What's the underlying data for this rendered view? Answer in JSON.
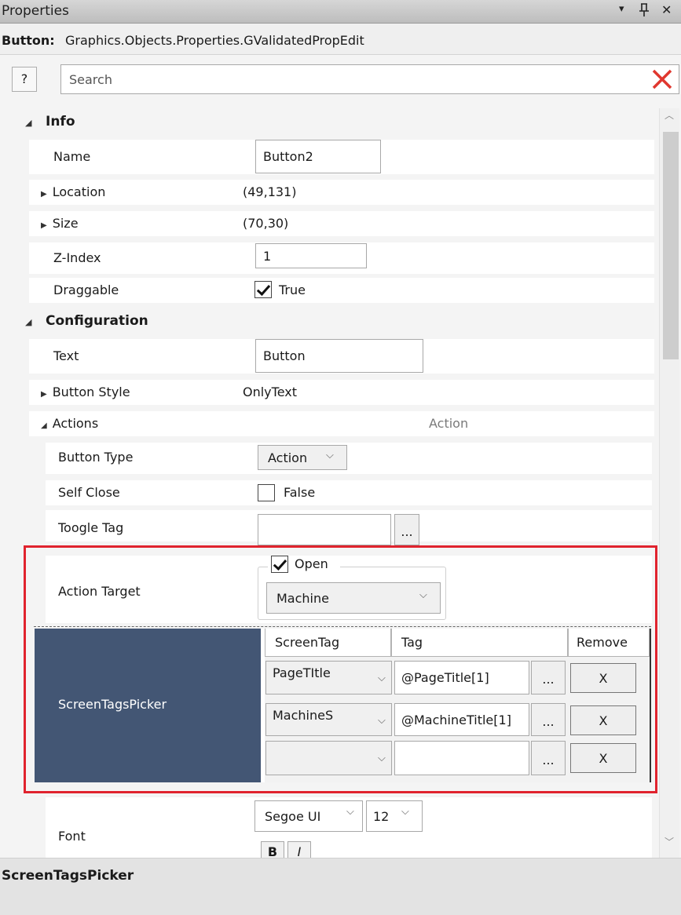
{
  "titlebar": {
    "title": "Properties",
    "pin_glyph": "ᵖ",
    "close_glyph": "✕",
    "menu_glyph": "▾",
    "icons": [
      "dropdown-icon",
      "pin-icon",
      "close-icon"
    ]
  },
  "object_type": {
    "label": "Button:",
    "name": "Graphics.Objects.Properties.GValidatedPropEdit"
  },
  "search": {
    "help_label": "?",
    "placeholder": "Search",
    "value": "",
    "clear_icon": "clear-x-icon"
  },
  "sections": {
    "info": "Info",
    "configuration": "Configuration"
  },
  "info": {
    "name": {
      "label": "Name",
      "value": "Button2"
    },
    "location": {
      "label": "Location",
      "value": "(49,131)"
    },
    "size": {
      "label": "Size",
      "value": "(70,30)"
    },
    "zindex": {
      "label": "Z-Index",
      "value": "1"
    },
    "draggable": {
      "label": "Draggable",
      "checked": true,
      "value": "True"
    }
  },
  "configuration": {
    "text": {
      "label": "Text",
      "value": "Button"
    },
    "button_style": {
      "label": "Button Style",
      "value": "OnlyText"
    },
    "actions": {
      "label": "Actions",
      "value": "Action"
    },
    "button_type": {
      "label": "Button Type",
      "value": "Action"
    },
    "self_close": {
      "label": "Self Close",
      "checked": false,
      "value": "False"
    },
    "toogle_tag": {
      "label": "Toogle Tag",
      "value": "",
      "browse": "..."
    },
    "action_target": {
      "label": "Action Target",
      "open_checked": true,
      "open_label": "Open",
      "target_value": "Machine"
    },
    "screen_tags_picker": {
      "label": "ScreenTagsPicker",
      "columns": [
        "ScreenTag",
        "Tag",
        "Remove"
      ],
      "rows": [
        {
          "screen_tag": "PageTItle",
          "tag": "@PageTitle[1]",
          "browse": "...",
          "remove": "X"
        },
        {
          "screen_tag": "MachineS",
          "tag": "@MachineTitle[1]",
          "browse": "...",
          "remove": "X"
        },
        {
          "screen_tag": "",
          "tag": "",
          "browse": "...",
          "remove": "X"
        }
      ]
    },
    "font": {
      "label": "Font",
      "family": "Segoe UI",
      "size": "12",
      "bold": "B",
      "italic": "I"
    }
  },
  "footer": {
    "selected_property": "ScreenTagsPicker"
  },
  "colors": {
    "highlight_border": "#e0232e",
    "picker_panel": "#435674",
    "clear_icon": "#e0372f"
  }
}
